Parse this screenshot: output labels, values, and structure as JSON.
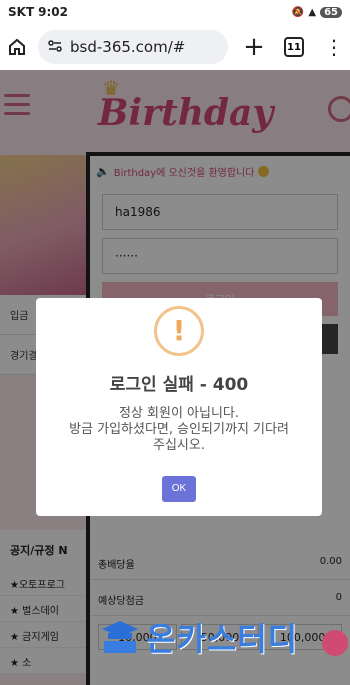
{
  "statusbar": {
    "carrier": "SKT",
    "time": "9:02",
    "battery": "65"
  },
  "browser": {
    "url": "bsd-365.com/#",
    "tab_count": "11"
  },
  "site": {
    "logo": "Birthday"
  },
  "side_links": [
    "입금",
    "경기결"
  ],
  "notice": {
    "title": "공지/규정 N",
    "items": [
      "★오토프로그",
      "★ 벌스데이 ",
      "★ 금지게임 ",
      "★ 소 "
    ]
  },
  "login": {
    "welcome": "Birthday에 오신것을 환영합니다",
    "username": "ha1986",
    "password": "······",
    "login_label": "로그인"
  },
  "bet_rows": [
    {
      "label": "총배당율",
      "value": "0.00"
    },
    {
      "label": "예상당첨금",
      "value": "0"
    }
  ],
  "amounts": [
    "10,000",
    "50,000",
    "100,000"
  ],
  "dialog": {
    "icon": "!",
    "title": "로그인 실패 - 400",
    "line1": "정상 회원이 아닙니다.",
    "line2": "방금 가입하셨다면, 승인되기까지 기다려",
    "line3": "주십시오.",
    "ok_label": "OK"
  },
  "watermark": {
    "text": "온카스터디"
  }
}
